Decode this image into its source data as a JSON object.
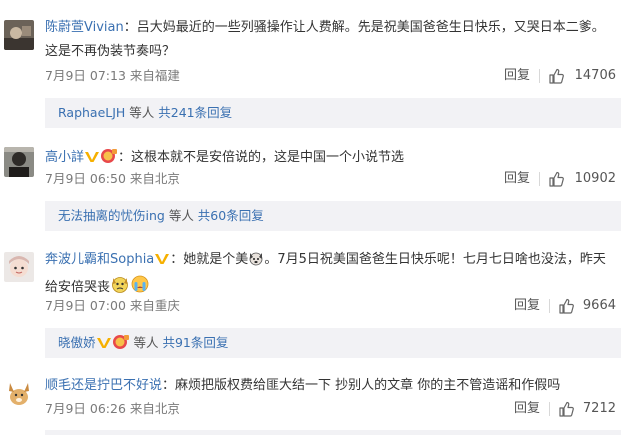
{
  "comments": [
    {
      "user": "陈蔚萱Vivian",
      "colon": "：",
      "text_line1": "吕大妈最近的一些列骚操作让人费解。先是祝美国爸爸生日快乐，又哭日本二爹。",
      "text_line2": "这是不再伪装节奏吗？",
      "time": "7月9日 07:13 来自福建",
      "reply_label": "回复",
      "likes": "14706",
      "sub_user": "RaphaeLJH",
      "sub_mid": " 等人 ",
      "sub_count": "共241条回复"
    },
    {
      "user": "高小詳",
      "colon": "：",
      "text_line1": "这根本就不是安倍说的，这是中国一个小说节选",
      "time": "7月9日 06:50 来自北京",
      "reply_label": "回复",
      "likes": "10902",
      "sub_user": "无法抽离的忧伤ing",
      "sub_mid": " 等人 ",
      "sub_count": "共60条回复"
    },
    {
      "user": "奔波儿霸和Sophia",
      "colon": "：",
      "text_line1_a": "她就是个美",
      "text_line1_b": "。7月5日祝美国爸爸生日快乐呢！七月七日啥也没法，昨天",
      "text_line2": "给安倍哭丧",
      "time": "7月9日 07:00 来自重庆",
      "reply_label": "回复",
      "likes": "9664",
      "sub_user": "晓傲娇",
      "sub_mid": " 等人 ",
      "sub_count": "共91条回复"
    },
    {
      "user": "顺毛还是拧巴不好说",
      "colon": "：",
      "text_line1": "麻烦把版权费给匪大结一下 抄别人的文章 你的主不管造谣和作假吗",
      "time": "7月9日 06:26 来自北京",
      "reply_label": "回复",
      "likes": "7212"
    }
  ],
  "colors": {
    "link": "#3a70b1",
    "subbox_bg": "#f2f2f5",
    "meta": "#7a7a7a",
    "vip_badge": "#f6b000"
  }
}
